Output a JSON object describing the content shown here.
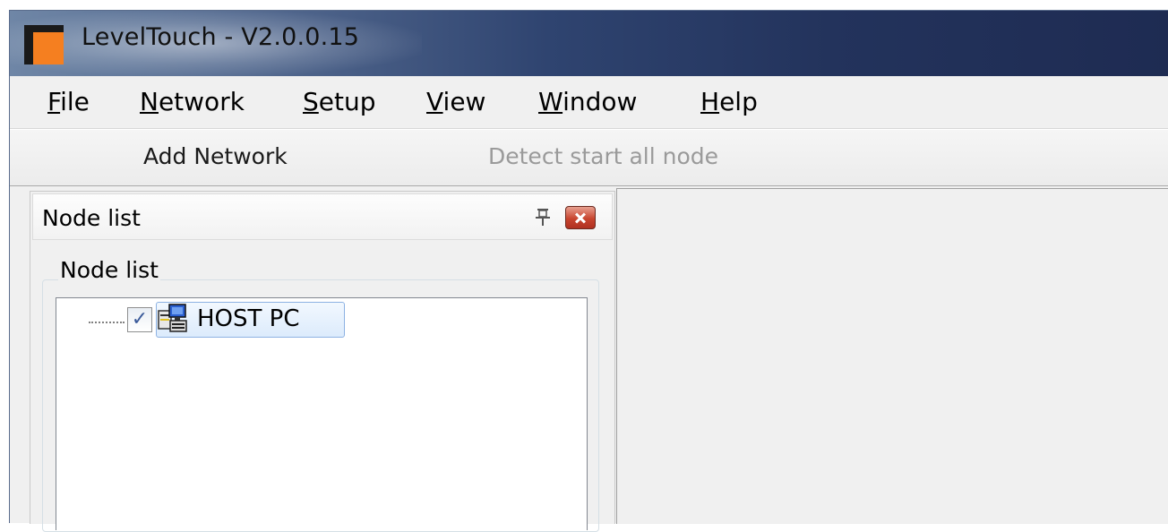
{
  "window": {
    "title": "LevelTouch - V2.0.0.15",
    "icon": "app-logo-icon"
  },
  "menu": [
    {
      "label": "File",
      "accel": "F",
      "rest": "ile"
    },
    {
      "label": "Network",
      "accel": "N",
      "rest": "etwork"
    },
    {
      "label": "Setup",
      "accel": "S",
      "rest": "etup"
    },
    {
      "label": "View",
      "accel": "V",
      "rest": "iew"
    },
    {
      "label": "Window",
      "accel": "W",
      "rest": "indow"
    },
    {
      "label": "Help",
      "accel": "H",
      "rest": "elp"
    }
  ],
  "toolbar": {
    "add_network": "Add Network",
    "detect_start": "Detect start all node",
    "detect_start_enabled": false
  },
  "node_panel": {
    "title": "Node list",
    "group_label": "Node list",
    "pin_icon": "pin-icon",
    "close_icon": "close-icon",
    "nodes": [
      {
        "label": "HOST PC",
        "checked": true,
        "icon": "host-pc-icon",
        "selected": true
      }
    ]
  },
  "colors": {
    "accent_orange": "#f57f20",
    "titlebar_dark": "#1e2b52",
    "selection_border": "#8db2e3"
  }
}
